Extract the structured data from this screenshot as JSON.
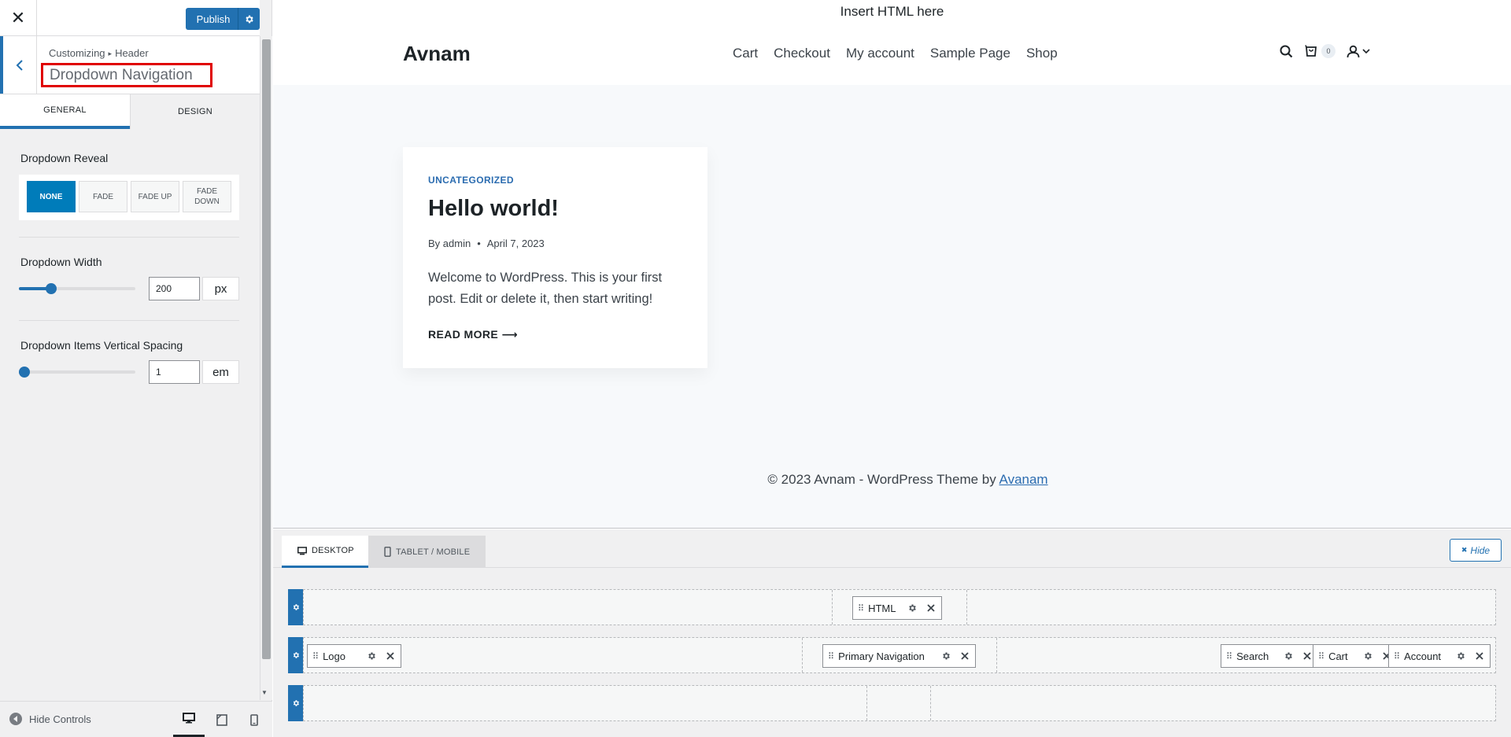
{
  "panel": {
    "close_label": "✕",
    "publish_label": "Publish",
    "breadcrumb_root": "Customizing",
    "breadcrumb_sep": "▸",
    "breadcrumb_section": "Header",
    "section_title": "Dropdown Navigation",
    "tabs": [
      {
        "label": "GENERAL",
        "active": true
      },
      {
        "label": "DESIGN",
        "active": false
      }
    ],
    "dropdown_reveal": {
      "label": "Dropdown Reveal",
      "options": [
        {
          "label": "NONE",
          "active": true
        },
        {
          "label": "FADE",
          "active": false
        },
        {
          "label": "FADE UP",
          "active": false
        },
        {
          "label": "FADE DOWN",
          "active": false
        }
      ]
    },
    "dropdown_width": {
      "label": "Dropdown Width",
      "value": "200",
      "unit": "px",
      "slider_fraction": 0.28
    },
    "vertical_spacing": {
      "label": "Dropdown Items Vertical Spacing",
      "value": "1",
      "unit": "em",
      "slider_fraction": 0.05
    },
    "footer": {
      "hide_controls_label": "Hide Controls"
    }
  },
  "preview": {
    "top_html": "Insert HTML here",
    "site_title": "Avnam",
    "nav_items": [
      "Cart",
      "Checkout",
      "My account",
      "Sample Page",
      "Shop"
    ],
    "cart_count": "0",
    "post": {
      "category": "UNCATEGORIZED",
      "title": "Hello world!",
      "author": "By admin",
      "meta_sep": "•",
      "date": "April 7, 2023",
      "excerpt": "Welcome to WordPress. This is your first post. Edit or delete it, then start writing!",
      "read_more": "READ MORE ⟶"
    },
    "footer_text": "© 2023 Avnam - WordPress Theme by ",
    "footer_link": "Avanam"
  },
  "builder": {
    "tabs": [
      {
        "label": "DESKTOP",
        "active": true
      },
      {
        "label": "TABLET / MOBILE",
        "active": false
      }
    ],
    "hide_label": "Hide",
    "hide_x": "✖",
    "rows": {
      "top": {
        "items": [
          "HTML"
        ]
      },
      "main": {
        "items": [
          "Logo",
          "Primary Navigation",
          "Search",
          "Cart",
          "Account"
        ]
      },
      "bottom": {
        "items": []
      }
    },
    "accent_color": "#2271b1"
  },
  "colors": {
    "accent": "#2271b1",
    "active_option": "#007cba",
    "highlight_border": "#e00000"
  }
}
